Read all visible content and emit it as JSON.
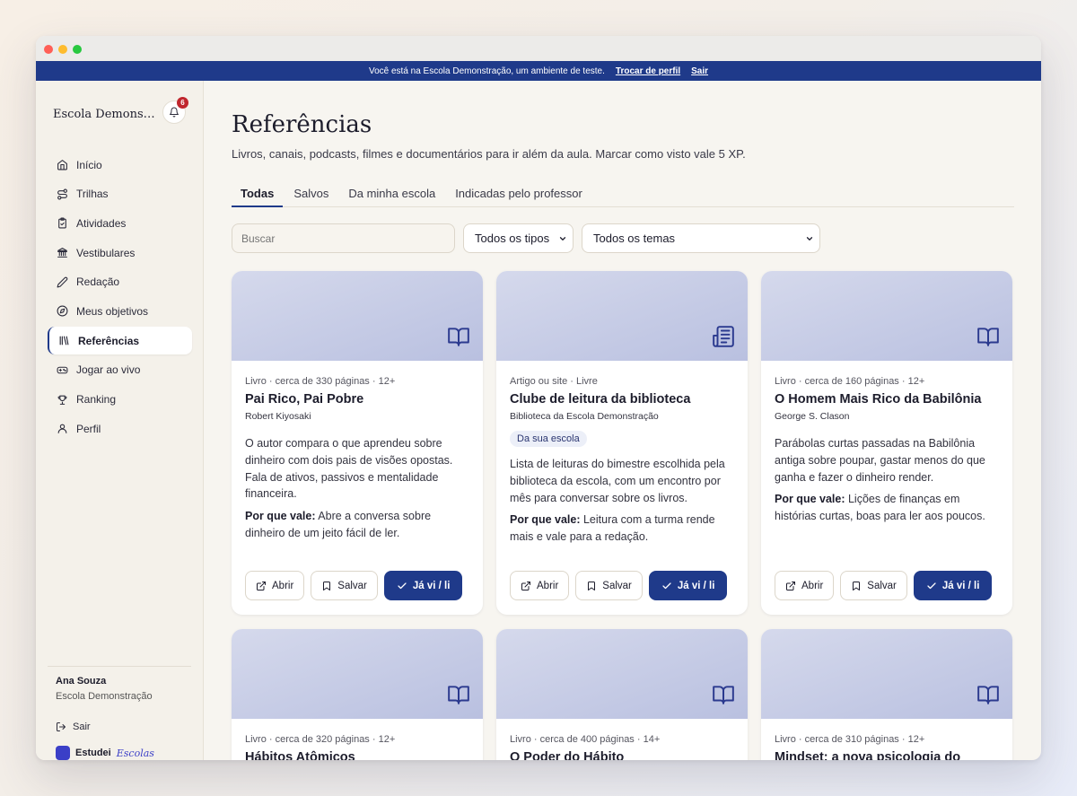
{
  "banner": {
    "text": "Você está na Escola Demonstração, um ambiente de teste.",
    "switch_profile": "Trocar de perfil",
    "exit": "Sair"
  },
  "sidebar": {
    "school_name": "Escola Demonstração",
    "notifications_count": "6",
    "items": [
      {
        "label": "Início",
        "icon": "home-icon"
      },
      {
        "label": "Trilhas",
        "icon": "route-icon"
      },
      {
        "label": "Atividades",
        "icon": "clipboard-icon"
      },
      {
        "label": "Vestibulares",
        "icon": "institution-icon"
      },
      {
        "label": "Redação",
        "icon": "pen-icon"
      },
      {
        "label": "Meus objetivos",
        "icon": "compass-icon"
      },
      {
        "label": "Referências",
        "icon": "library-icon",
        "active": true
      },
      {
        "label": "Jogar ao vivo",
        "icon": "gamepad-icon"
      },
      {
        "label": "Ranking",
        "icon": "trophy-icon"
      },
      {
        "label": "Perfil",
        "icon": "user-icon"
      }
    ],
    "user_name": "Ana Souza",
    "user_school": "Escola Demonstração",
    "logout": "Sair",
    "brand_name": "Estudei",
    "brand_suffix": "Escolas"
  },
  "main": {
    "title": "Referências",
    "subtitle": "Livros, canais, podcasts, filmes e documentários para ir além da aula. Marcar como visto vale 5 XP.",
    "tabs": [
      "Todas",
      "Salvos",
      "Da minha escola",
      "Indicadas pelo professor"
    ],
    "search_placeholder": "Buscar",
    "filter_type": "Todos os tipos",
    "filter_theme": "Todos os temas",
    "why_label": "Por que vale:",
    "btn_open": "Abrir",
    "btn_save": "Salvar",
    "btn_seen": "Já vi / li",
    "cards": [
      {
        "icon": "book-icon",
        "meta": "Livro · cerca de 330 páginas · 12+",
        "title": "Pai Rico, Pai Pobre",
        "author": "Robert Kiyosaki",
        "desc": "O autor compara o que aprendeu sobre dinheiro com dois pais de visões opostas. Fala de ativos, passivos e mentalidade financeira.",
        "why": "Abre a conversa sobre dinheiro de um jeito fácil de ler."
      },
      {
        "icon": "newspaper-icon",
        "meta": "Artigo ou site · Livre",
        "title": "Clube de leitura da biblioteca",
        "author": "Biblioteca da Escola Demonstração",
        "tag": "Da sua escola",
        "desc": "Lista de leituras do bimestre escolhida pela biblioteca da escola, com um encontro por mês para conversar sobre os livros.",
        "why": "Leitura com a turma rende mais e vale para a redação."
      },
      {
        "icon": "book-icon",
        "meta": "Livro · cerca de 160 páginas · 12+",
        "title": "O Homem Mais Rico da Babilônia",
        "author": "George S. Clason",
        "desc": "Parábolas curtas passadas na Babilônia antiga sobre poupar, gastar menos do que ganha e fazer o dinheiro render.",
        "why": "Lições de finanças em histórias curtas, boas para ler aos poucos."
      },
      {
        "icon": "book-icon",
        "meta": "Livro · cerca de 320 páginas · 12+",
        "title": "Hábitos Atômicos"
      },
      {
        "icon": "book-icon",
        "meta": "Livro · cerca de 400 páginas · 14+",
        "title": "O Poder do Hábito"
      },
      {
        "icon": "book-icon",
        "meta": "Livro · cerca de 310 páginas · 12+",
        "title": "Mindset: a nova psicologia do"
      }
    ]
  }
}
